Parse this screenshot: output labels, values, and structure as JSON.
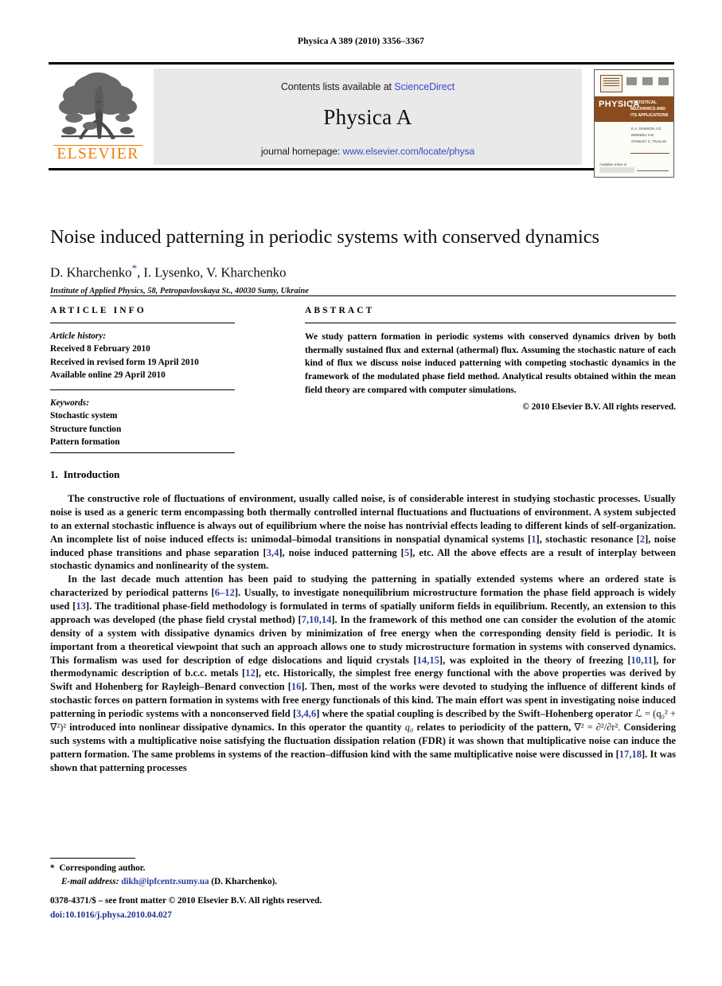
{
  "running_head": "Physica A 389 (2010) 3356–3367",
  "masthead": {
    "contents_prefix": "Contents lists available at ",
    "sciencedirect": "ScienceDirect",
    "journal_title": "Physica A",
    "homepage_prefix": "journal homepage: ",
    "homepage_url": "www.elsevier.com/locate/physa",
    "publisher_wordmark": "ELSEVIER",
    "cover": {
      "band_text": "PHYSICA",
      "band_letter": "A",
      "subtitle": "STATISTICAL MECHANICS AND ITS APPLICATIONS",
      "editors": "K.A. DAWSON\nJ.O. INDEKEU\nH.E. STANLEY\nC. TSALLIS",
      "sciencedirect_caption": "Available online at"
    }
  },
  "article": {
    "title": "Noise induced patterning in periodic systems with conserved dynamics",
    "authors": "D. Kharchenko",
    "authors_rest": ", I. Lysenko, V. Kharchenko",
    "corresponding_marker": "*",
    "affiliation": "Institute of Applied Physics, 58, Petropavlovskaya St., 40030 Sumy, Ukraine"
  },
  "info": {
    "heading": "ARTICLE INFO",
    "history_label": "Article history:",
    "history": [
      "Received 8 February 2010",
      "Received in revised form 19 April 2010",
      "Available online 29 April 2010"
    ],
    "keywords_label": "Keywords:",
    "keywords": [
      "Stochastic system",
      "Structure function",
      "Pattern formation"
    ]
  },
  "abstract": {
    "heading": "ABSTRACT",
    "text": "We study pattern formation in periodic systems with conserved dynamics driven by both thermally sustained flux and external (athermal) flux. Assuming the stochastic nature of each kind of flux we discuss noise induced patterning with competing stochastic dynamics in the framework of the modulated phase field method. Analytical results obtained within the mean field theory are compared with computer simulations.",
    "copyright": "© 2010 Elsevier B.V. All rights reserved."
  },
  "body": {
    "section_number": "1.",
    "section_title": "Introduction",
    "para1_a": "The constructive role of fluctuations of environment, usually called noise, is of considerable interest in studying stochastic processes. Usually noise is used as a generic term encompassing both thermally controlled internal fluctuations and fluctuations of environment. A system subjected to an external stochastic influence is always out of equilibrium where the noise has nontrivial effects leading to different kinds of self-organization. An incomplete list of noise induced effects is: unimodal–bimodal transitions in nonspatial dynamical systems [",
    "c1": "1",
    "para1_b": "], stochastic resonance [",
    "c2": "2",
    "para1_c": "], noise induced phase transitions and phase separation [",
    "c3": "3,4",
    "para1_d": "], noise induced patterning [",
    "c5": "5",
    "para1_e": "], etc. All the above effects are a result of interplay between stochastic dynamics and nonlinearity of the system.",
    "para2_a": "In the last decade much attention has been paid to studying the patterning in spatially extended systems where an ordered state is characterized by periodical patterns [",
    "c6": "6–12",
    "para2_b": "]. Usually, to investigate nonequilibrium microstructure formation the phase field approach is widely used [",
    "c13": "13",
    "para2_c": "]. The traditional phase-field methodology is formulated in terms of spatially uniform fields in equilibrium. Recently, an extension to this approach was developed (the phase field crystal method) [",
    "c7": "7,10,14",
    "para2_d": "]. In the framework of this method one can consider the evolution of the atomic density of a system with dissipative dynamics driven by minimization of free energy when the corresponding density field is periodic. It is important from a theoretical viewpoint that such an approach allows one to study microstructure formation in systems with conserved dynamics. This formalism was used for description of edge dislocations and liquid crystals [",
    "c14": "14,15",
    "para2_e": "], was exploited in the theory of freezing [",
    "c10": "10,11",
    "para2_f": "], for thermodynamic description of b.c.c. metals [",
    "c12": "12",
    "para2_g": "], etc. Historically, the simplest free energy functional with the above properties was derived by Swift and Hohenberg for Rayleigh–Benard convection [",
    "c16": "16",
    "para2_h": "]. Then, most of the works were devoted to studying the influence of different kinds of stochastic forces on pattern formation in systems with free energy functionals of this kind. The main effort was spent in investigating noise induced patterning in periodic systems with a nonconserved field [",
    "c346": "3,4,6",
    "para2_i": "] where the spatial coupling is described by the Swift–Hohenberg operator ",
    "formula1": "ℒ = (q₀² + ∇²)²",
    "para2_j": " introduced into nonlinear dissipative dynamics. In this operator the quantity ",
    "q0": "q₀",
    "para2_k": " relates to periodicity of the pattern, ",
    "formula2": "∇² = ∂²/∂r².",
    "para2_l": " Considering such systems with a multiplicative noise satisfying the fluctuation dissipation relation (FDR) it was shown that multiplicative noise can induce the pattern formation. The same problems in systems of the reaction–diffusion kind with the same multiplicative noise were discussed in [",
    "c1718": "17,18",
    "para2_m": "]. It was shown that patterning processes"
  },
  "footnote": {
    "star": "*",
    "corresponding": "Corresponding author.",
    "email_label": "E-mail address:",
    "email": "dikh@ipfcentr.sumy.ua",
    "email_owner": "(D. Kharchenko)."
  },
  "imprint": {
    "issn_line": "0378-4371/$ – see front matter © 2010 Elsevier B.V. All rights reserved.",
    "doi": "doi:10.1016/j.physa.2010.04.027"
  }
}
